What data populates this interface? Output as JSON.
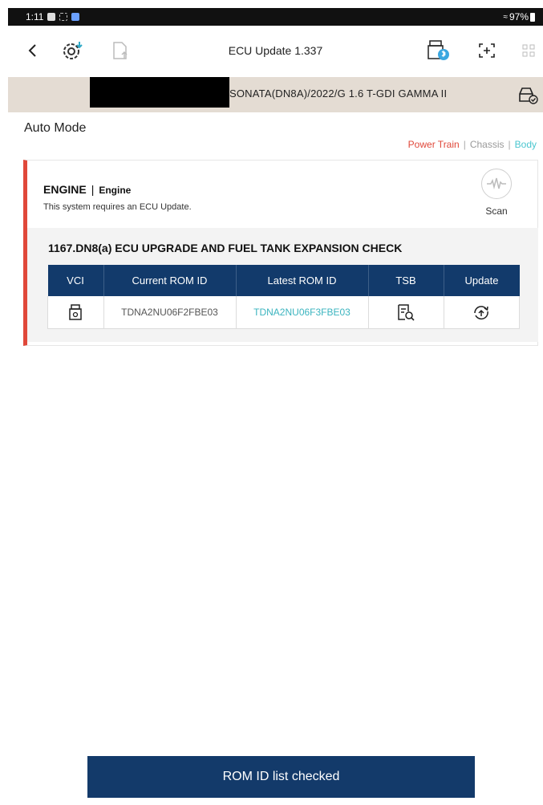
{
  "status_bar": {
    "time": "1:11",
    "battery": "97%"
  },
  "header": {
    "title": "ECU Update 1.337",
    "icons": {
      "back": "chevron-left-icon",
      "ecu_update": "gear-download-icon",
      "export": "file-upload-icon",
      "vci_bluetooth": "vci-bluetooth-icon",
      "capture": "screen-capture-icon",
      "menu": "grid-menu-icon"
    }
  },
  "vehicle": {
    "info": "SONATA(DN8A)/2022/G 1.6 T-GDI GAMMA II",
    "icon": "car-check-icon"
  },
  "content": {
    "mode_title": "Auto Mode",
    "filters": [
      {
        "label": "Power Train",
        "color": "#e0483a"
      },
      {
        "label": "Chassis",
        "color": "#999999"
      },
      {
        "label": "Body",
        "color": "#4bc6cf"
      }
    ],
    "separator": "|"
  },
  "system": {
    "name": "ENGINE",
    "separator": "|",
    "sub_name": "Engine",
    "message": "This system requires an ECU Update.",
    "scan_label": "Scan",
    "accent_color": "#e0483a"
  },
  "update_item": {
    "title": "1167.DN8(a) ECU UPGRADE AND FUEL TANK EXPANSION CHECK",
    "columns": [
      "VCI",
      "Current ROM ID",
      "Latest ROM ID",
      "TSB",
      "Update"
    ],
    "row": {
      "vci_icon": "vci-device-icon",
      "current_rom_id": "TDNA2NU06F2FBE03",
      "latest_rom_id": "TDNA2NU06F3FBE03",
      "tsb_icon": "document-search-icon",
      "update_icon": "update-circle-icon"
    }
  },
  "footer": {
    "button_label": "ROM ID list checked",
    "button_color": "#133a6a"
  }
}
